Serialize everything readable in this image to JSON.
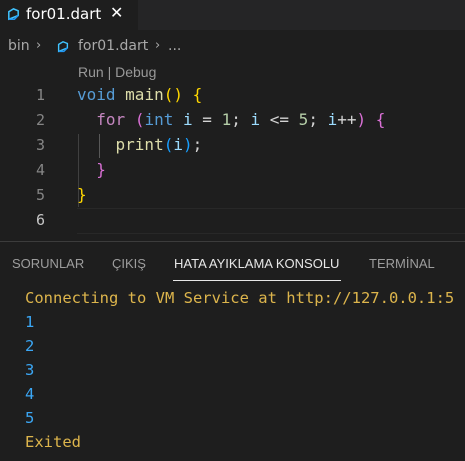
{
  "tab": {
    "label": "for01.dart",
    "close": "✕"
  },
  "breadcrumb": {
    "folder": "bin",
    "file": "for01.dart",
    "more": "..."
  },
  "codelens": "Run | Debug",
  "lines": [
    {
      "n": "1"
    },
    {
      "n": "2"
    },
    {
      "n": "3"
    },
    {
      "n": "4"
    },
    {
      "n": "5"
    },
    {
      "n": "6"
    }
  ],
  "code": {
    "l1": [
      "void",
      "main",
      "()",
      "{"
    ],
    "l2": [
      "for",
      "(",
      "int",
      "i",
      "=",
      "1",
      ";",
      "i",
      "<=",
      "5",
      ";",
      "i",
      "++",
      ")",
      "{"
    ],
    "l3": [
      "print",
      "(",
      "i",
      ")",
      ";"
    ],
    "l4": [
      "}"
    ],
    "l5": [
      "}"
    ]
  },
  "panel": {
    "tabs": [
      "SORUNLAR",
      "ÇIKIŞ",
      "HATA AYIKLAMA KONSOLU",
      "TERMİNAL"
    ],
    "active_tab": "HATA AYIKLAMA KONSOLU",
    "console": [
      "Connecting to VM Service at http://127.0.0.1:5",
      "1",
      "2",
      "3",
      "4",
      "5",
      "Exited"
    ]
  },
  "colors": {
    "accent_yellow": "#ddb54c",
    "output_blue": "#3ba7f5",
    "background": "#1e1e1e"
  }
}
